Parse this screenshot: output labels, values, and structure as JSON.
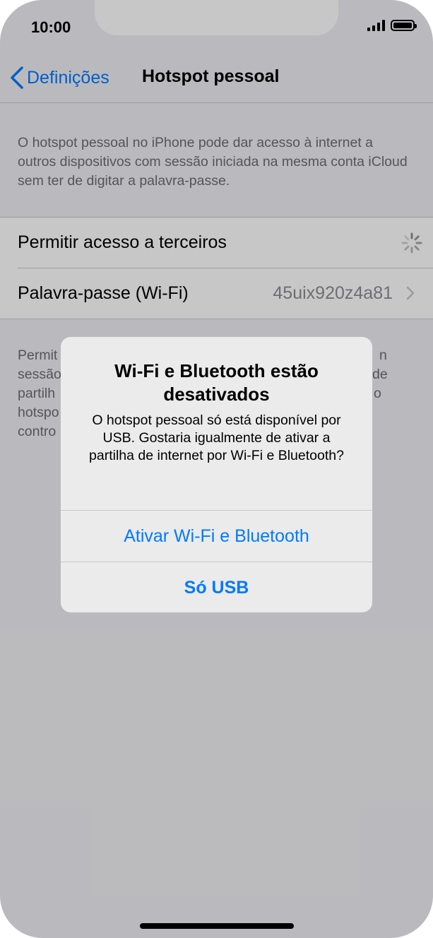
{
  "status_bar": {
    "time": "10:00",
    "signal_icon": "cellular-signal-icon",
    "battery_icon": "battery-full-icon"
  },
  "nav": {
    "back_label": "Definições",
    "title": "Hotspot pessoal"
  },
  "description": "O hotspot pessoal no iPhone pode dar acesso à internet a outros dispositivos com sessão iniciada na mesma conta iCloud sem ter de digitar a palavra-passe.",
  "settings": {
    "allow_others_label": "Permitir acesso a terceiros",
    "password_label": "Palavra-passe (Wi-Fi)",
    "password_value": "45uix920z4a81"
  },
  "footer_text_lines": [
    "Permit",
    "sessão",
    "partilh",
    "hotspo",
    "contro"
  ],
  "footer_text_right": [
    "n",
    "de",
    "o"
  ],
  "alert": {
    "title": "Wi-Fi e Bluetooth estão desativados",
    "message": "O hotspot pessoal só está disponível por USB. Gostaria igualmente de ativar a partilha de internet por Wi-Fi e Bluetooth?",
    "primary_button": "Ativar Wi-Fi e Bluetooth",
    "secondary_button": "Só USB"
  },
  "colors": {
    "accent": "#007aff",
    "background": "#efeff4"
  }
}
